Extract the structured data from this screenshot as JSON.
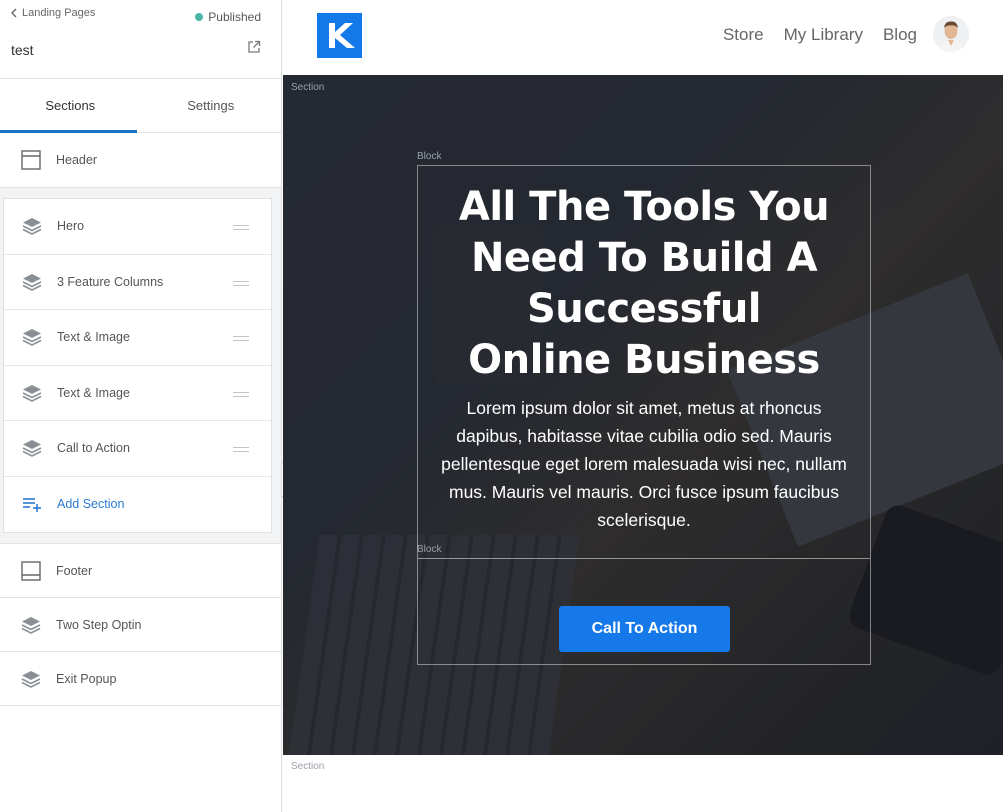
{
  "sidebar": {
    "back_label": "Landing Pages",
    "status_label": "Published",
    "status_color": "#4ab5a7",
    "page_name": "test",
    "tabs": [
      {
        "label": "Sections"
      },
      {
        "label": "Settings"
      }
    ],
    "header_item": {
      "label": "Header",
      "icon": "layout-header-icon"
    },
    "sections": [
      {
        "label": "Hero",
        "icon": "layers-icon"
      },
      {
        "label": "3 Feature Columns",
        "icon": "layers-icon"
      },
      {
        "label": "Text & Image",
        "icon": "layers-icon"
      },
      {
        "label": "Text & Image",
        "icon": "layers-icon"
      },
      {
        "label": "Call to Action",
        "icon": "layers-icon"
      }
    ],
    "add_section_label": "Add Section",
    "footer_item": {
      "label": "Footer",
      "icon": "layout-footer-icon"
    },
    "extra_items": [
      {
        "label": "Two Step Optin",
        "icon": "layers-icon"
      },
      {
        "label": "Exit Popup",
        "icon": "layers-icon"
      }
    ]
  },
  "site": {
    "nav": [
      "Store",
      "My Library",
      "Blog"
    ],
    "brand_color": "#1479e8"
  },
  "hero": {
    "section_label": "Section",
    "block_label_1": "Block",
    "block_label_2": "Block",
    "title": "All The Tools You Need To Build A Successful Online Business",
    "body": "Lorem ipsum dolor sit amet, metus at rhoncus dapibus, habitasse vitae cubilia odio sed. Mauris pellentesque eget lorem malesuada wisi nec, nullam mus. Mauris vel mauris. Orci fusce ipsum faucibus scelerisque.",
    "cta_label": "Call To Action",
    "cta_color": "#1579ea"
  },
  "next_section_label": "Section"
}
